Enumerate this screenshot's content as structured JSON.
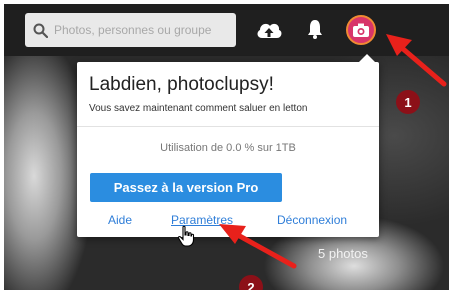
{
  "search": {
    "placeholder": "Photos, personnes ou groupe"
  },
  "topbar": {
    "upload_icon": "cloud-upload-icon",
    "notifications_icon": "bell-icon",
    "avatar_icon": "camera-icon"
  },
  "menu": {
    "greeting": "Labdien, photoclupsy!",
    "subtitle": "Vous savez maintenant comment saluer en letton",
    "usage": "Utilisation de 0.0 % sur 1TB",
    "pro_button": "Passez à la version Pro",
    "links": {
      "help": "Aide",
      "settings": "Paramètres",
      "logout": "Déconnexion"
    }
  },
  "photos_count": "5 photos",
  "annotations": {
    "step1": "1",
    "step2": "2",
    "arrow_color": "#e8211b"
  },
  "colors": {
    "accent": "#2b8de0",
    "link": "#2f7ed8",
    "badge": "#8c1018"
  }
}
